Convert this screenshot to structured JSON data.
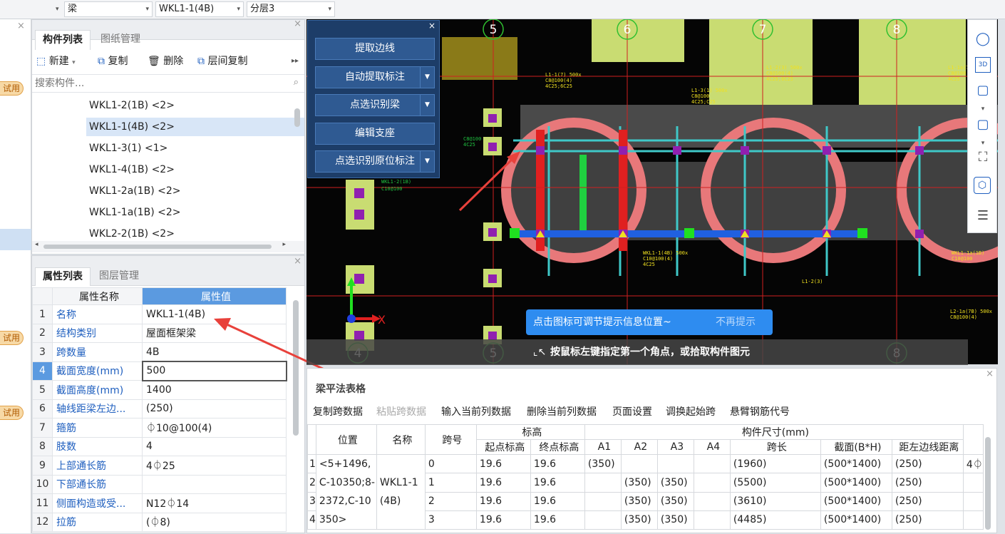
{
  "toolbar": {
    "combo1": "梁",
    "combo2": "WKL1-1(4B)",
    "combo3": "分层3"
  },
  "leftstrip": {
    "trial_label": "试用"
  },
  "component_panel": {
    "tabs": [
      "构件列表",
      "图纸管理"
    ],
    "buttons": {
      "new": "新建",
      "copy": "复制",
      "delete": "删除",
      "floor_copy": "层间复制"
    },
    "search_placeholder": "搜索构件...",
    "items": [
      "WKL1-2(1B) <2>",
      "WKL1-1(4B) <2>",
      "WKL1-3(1) <1>",
      "WKL1-4(1B) <2>",
      "WKL1-2a(1B) <2>",
      "WKL1-1a(1B) <2>",
      "WKL2-2(1B) <2>"
    ],
    "selected_index": 1
  },
  "property_panel": {
    "tabs": [
      "属性列表",
      "图层管理"
    ],
    "headers": [
      "属性名称",
      "属性值"
    ],
    "rows": [
      {
        "n": "1",
        "name": "名称",
        "value": "WKL1-1(4B)"
      },
      {
        "n": "2",
        "name": "结构类别",
        "value": "屋面框架梁"
      },
      {
        "n": "3",
        "name": "跨数量",
        "value": "4B"
      },
      {
        "n": "4",
        "name": "截面宽度(mm)",
        "value": "500"
      },
      {
        "n": "5",
        "name": "截面高度(mm)",
        "value": "1400"
      },
      {
        "n": "6",
        "name": "轴线距梁左边...",
        "value": "(250)"
      },
      {
        "n": "7",
        "name": "箍筋",
        "value": "⏀10@100(4)"
      },
      {
        "n": "8",
        "name": "肢数",
        "value": "4"
      },
      {
        "n": "9",
        "name": "上部通长筋",
        "value": "4⏀25"
      },
      {
        "n": "10",
        "name": "下部通长筋",
        "value": ""
      },
      {
        "n": "11",
        "name": "侧面构造或受...",
        "value": "N12⏀14"
      },
      {
        "n": "12",
        "name": "拉筋",
        "value": "(⏀8)"
      }
    ]
  },
  "float_menu": {
    "buttons": [
      "提取边线",
      "自动提取标注",
      "点选识别梁",
      "编辑支座",
      "点选识别原位标注"
    ]
  },
  "cad": {
    "axis_top": [
      "5",
      "6",
      "7",
      "8"
    ],
    "axis_bottom": [
      "4",
      "5",
      "8"
    ],
    "axis_x": "X",
    "tooltip": "点击图标可调节提示信息位置~",
    "tooltip_dismiss": "不再提示",
    "hint": "按鼠标左键指定第一个角点，或拾取构件图元"
  },
  "right_tools": [
    "3D"
  ],
  "table_panel": {
    "title": "梁平法表格",
    "buttons": [
      "复制跨数据",
      "粘贴跨数据",
      "输入当前列数据",
      "删除当前列数据",
      "页面设置",
      "调换起始跨",
      "悬臂钢筋代号"
    ],
    "header_top": {
      "pos": "位置",
      "name": "名称",
      "span": "跨号",
      "elev": "标高",
      "size": "构件尺寸(mm)"
    },
    "header_sub": [
      "起点标高",
      "终点标高",
      "A1",
      "A2",
      "A3",
      "A4",
      "跨长",
      "截面(B*H)",
      "距左边线距离"
    ],
    "position_text": "<5+1496,C-10350;8-2372,C-10350>",
    "name_text": "WKL1-1(4B)",
    "rows": [
      {
        "i": "1",
        "span": "0",
        "s": "19.6",
        "e": "19.6",
        "a1": "(350)",
        "a2": "",
        "a3": "",
        "a4": "",
        "len": "(1960)",
        "sec": "(500*1400)",
        "dist": "(250)",
        "extra": "4⏀"
      },
      {
        "i": "2",
        "span": "1",
        "s": "19.6",
        "e": "19.6",
        "a1": "",
        "a2": "(350)",
        "a3": "(350)",
        "a4": "",
        "len": "(5500)",
        "sec": "(500*1400)",
        "dist": "(250)",
        "extra": ""
      },
      {
        "i": "3",
        "span": "2",
        "s": "19.6",
        "e": "19.6",
        "a1": "",
        "a2": "(350)",
        "a3": "(350)",
        "a4": "",
        "len": "(3610)",
        "sec": "(500*1400)",
        "dist": "(250)",
        "extra": ""
      },
      {
        "i": "4",
        "span": "3",
        "s": "19.6",
        "e": "19.6",
        "a1": "",
        "a2": "(350)",
        "a3": "(350)",
        "a4": "",
        "len": "(4485)",
        "sec": "(500*1400)",
        "dist": "(250)",
        "extra": ""
      }
    ]
  },
  "colors": {
    "accent": "#2e8cf0",
    "annotation_arrow": "#e8413b",
    "beam_pink": "#e8787a",
    "selected_row": "#d8e6f7"
  }
}
